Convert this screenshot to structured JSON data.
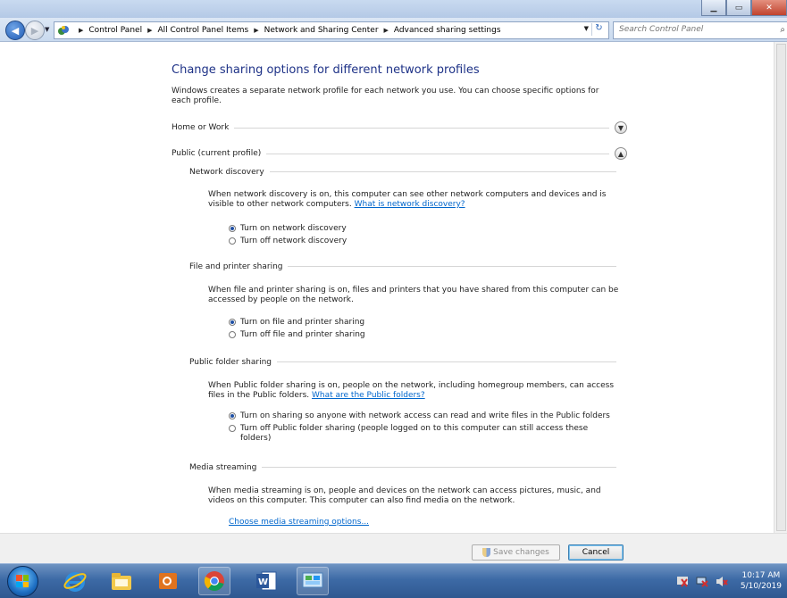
{
  "window": {
    "minimize": "▁",
    "maximize": "▭",
    "close": "✕"
  },
  "address": {
    "crumbs": [
      "Control Panel",
      "All Control Panel Items",
      "Network and Sharing Center",
      "Advanced sharing settings"
    ],
    "search_placeholder": "Search Control Panel"
  },
  "page": {
    "title": "Change sharing options for different network profiles",
    "intro": "Windows creates a separate network profile for each network you use. You can choose specific options for each profile.",
    "profiles": {
      "home": "Home or Work",
      "public": "Public (current profile)"
    },
    "network_discovery": {
      "heading": "Network discovery",
      "text": "When network discovery is on, this computer can see other network computers and devices and is visible to other network computers. ",
      "link": "What is network discovery?",
      "on": "Turn on network discovery",
      "off": "Turn off network discovery",
      "selected": "on"
    },
    "file_printer": {
      "heading": "File and printer sharing",
      "text": "When file and printer sharing is on, files and printers that you have shared from this computer can be accessed by people on the network.",
      "on": "Turn on file and printer sharing",
      "off": "Turn off file and printer sharing",
      "selected": "on"
    },
    "public_folder": {
      "heading": "Public folder sharing",
      "text": "When Public folder sharing is on, people on the network, including homegroup members, can access files in the Public folders. ",
      "link": "What are the Public folders?",
      "on": "Turn on sharing so anyone with network access can read and write files in the Public folders",
      "off": "Turn off Public folder sharing (people logged on to this computer can still access these folders)",
      "selected": "on"
    },
    "media": {
      "heading": "Media streaming",
      "text": "When media streaming is on, people and devices on the network can access pictures, music, and videos on this computer. This computer can also find media on the network.",
      "link": "Choose media streaming options..."
    }
  },
  "footer": {
    "save": "Save changes",
    "cancel": "Cancel"
  },
  "taskbar": {
    "time": "10:17 AM",
    "date": "5/10/2019"
  }
}
